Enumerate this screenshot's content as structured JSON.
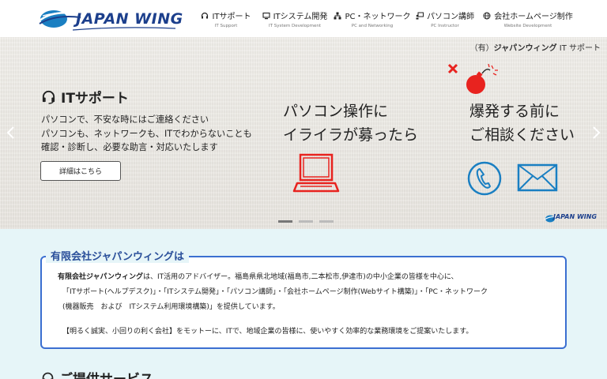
{
  "logo": {
    "text": "JAPAN WING"
  },
  "nav": [
    {
      "label": "ITサポート",
      "sub": "IT Support",
      "icon": "headset-icon"
    },
    {
      "label": "ITシステム開発",
      "sub": "IT System Development",
      "icon": "monitor-icon"
    },
    {
      "label": "PC・ネットワーク",
      "sub": "PC and Networking",
      "icon": "network-icon"
    },
    {
      "label": "パソコン講師",
      "sub": "PC Instructor",
      "icon": "teacher-icon"
    },
    {
      "label": "会社ホームページ制作",
      "sub": "Website Development",
      "icon": "globe-icon"
    }
  ],
  "breadcrumb": {
    "prefix": "（有）",
    "company": "ジャパンウィング",
    "suffix": " IT サポート"
  },
  "slide": {
    "title": "ITサポート",
    "desc": [
      "パソコンで、不安な時にはご連絡ください",
      "パソコンも、ネットワークも、ITでわからないことも",
      "確認・診断し、必要な助言・対応いたします"
    ],
    "button": "詳細はこちら",
    "headline_left": [
      "パソコン操作に",
      "イライラが募ったら"
    ],
    "headline_right": [
      "爆発する前に",
      "ご相談ください"
    ],
    "mini_logo": "JAPAN WING"
  },
  "slider": {
    "count": 3,
    "active": 0
  },
  "about": {
    "title": "有限会社ジャパンウィングは",
    "lines": [
      "有限会社ジャパンウィングは、IT活用のアドバイザー。福島県県北地域(福島市,二本松市,伊達市)の中小企業の皆様を中心に、",
      "「ITサポート(ヘルプデスク)」・「ITシステム開発」・「パソコン講師」・「会社ホームページ制作(Webサイト構築)」・「PC・ネットワーク",
      "(機器販売　および　ITシステム利用環境構築)」を提供しています。",
      "【明るく誠実、小回りの利く会社】をモットーに、ITで、地域企業の皆様に、使いやすく効率的な業務環境をご提案いたします。"
    ],
    "bold_lead": "有限会社ジャパンウィング"
  },
  "services": {
    "title": "ご提供サービス"
  },
  "colors": {
    "brand": "#1c3f8c",
    "accent": "#3b6fd1",
    "red": "#e8231f",
    "icon_blue": "#1a7fc2"
  }
}
